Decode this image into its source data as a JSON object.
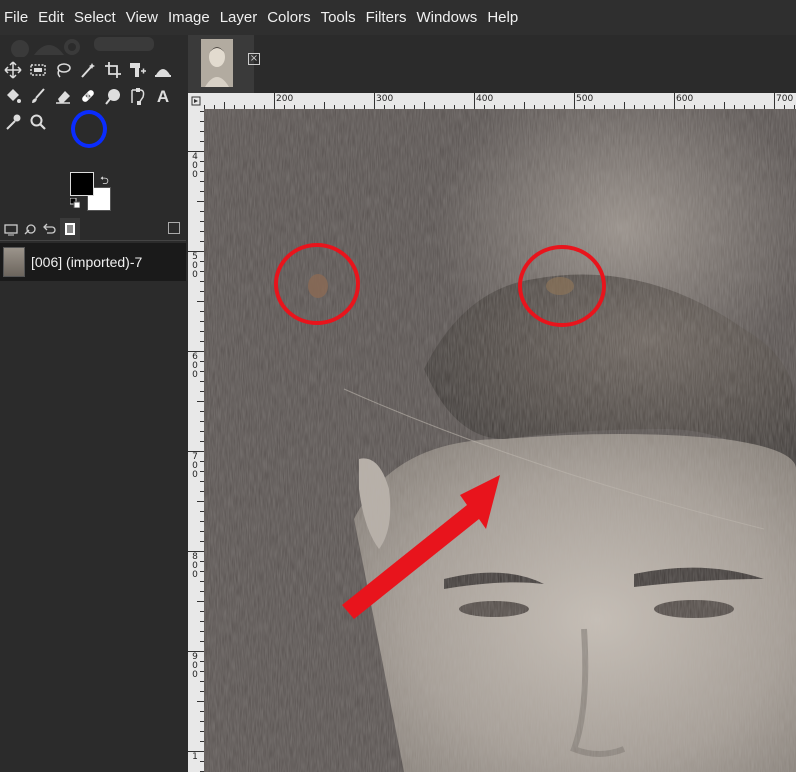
{
  "menu": [
    "File",
    "Edit",
    "Select",
    "View",
    "Image",
    "Layer",
    "Colors",
    "Tools",
    "Filters",
    "Windows",
    "Help"
  ],
  "toolbox": {
    "rows": [
      [
        "move-tool-icon",
        "rect-select-tool-icon",
        "lasso-tool-icon",
        "fuzzy-select-tool-icon",
        "crop-tool-icon",
        "unified-transform-tool-icon",
        "warp-transform-tool-icon"
      ],
      [
        "bucket-fill-tool-icon",
        "paintbrush-tool-icon",
        "eraser-tool-icon",
        "heal-tool-icon",
        "smudge-tool-icon",
        "paths-tool-icon",
        "text-tool-icon"
      ],
      [
        "color-picker-tool-icon",
        "zoom-tool-icon"
      ]
    ],
    "selected_tool": "heal-tool-icon",
    "highlight_color": "#0a2cff"
  },
  "colors": {
    "foreground": "#000000",
    "background": "#ffffff"
  },
  "panel_tabs": [
    "tool-options-tab-icon",
    "device-status-tab-icon",
    "undo-history-tab-icon",
    "images-tab-icon"
  ],
  "images_list": [
    {
      "label": "[006] (imported)-7"
    }
  ],
  "image_tabs": [
    {
      "thumb": "image-thumbnail"
    }
  ],
  "ruler": {
    "h_labels": [
      "200",
      "300",
      "400",
      "500",
      "600",
      "700"
    ],
    "v_labels": [
      "400",
      "500",
      "600",
      "700",
      "800",
      "900",
      "1"
    ]
  },
  "annotations": {
    "circle_color": "#e8141c",
    "arrow_color": "#e8141c"
  }
}
